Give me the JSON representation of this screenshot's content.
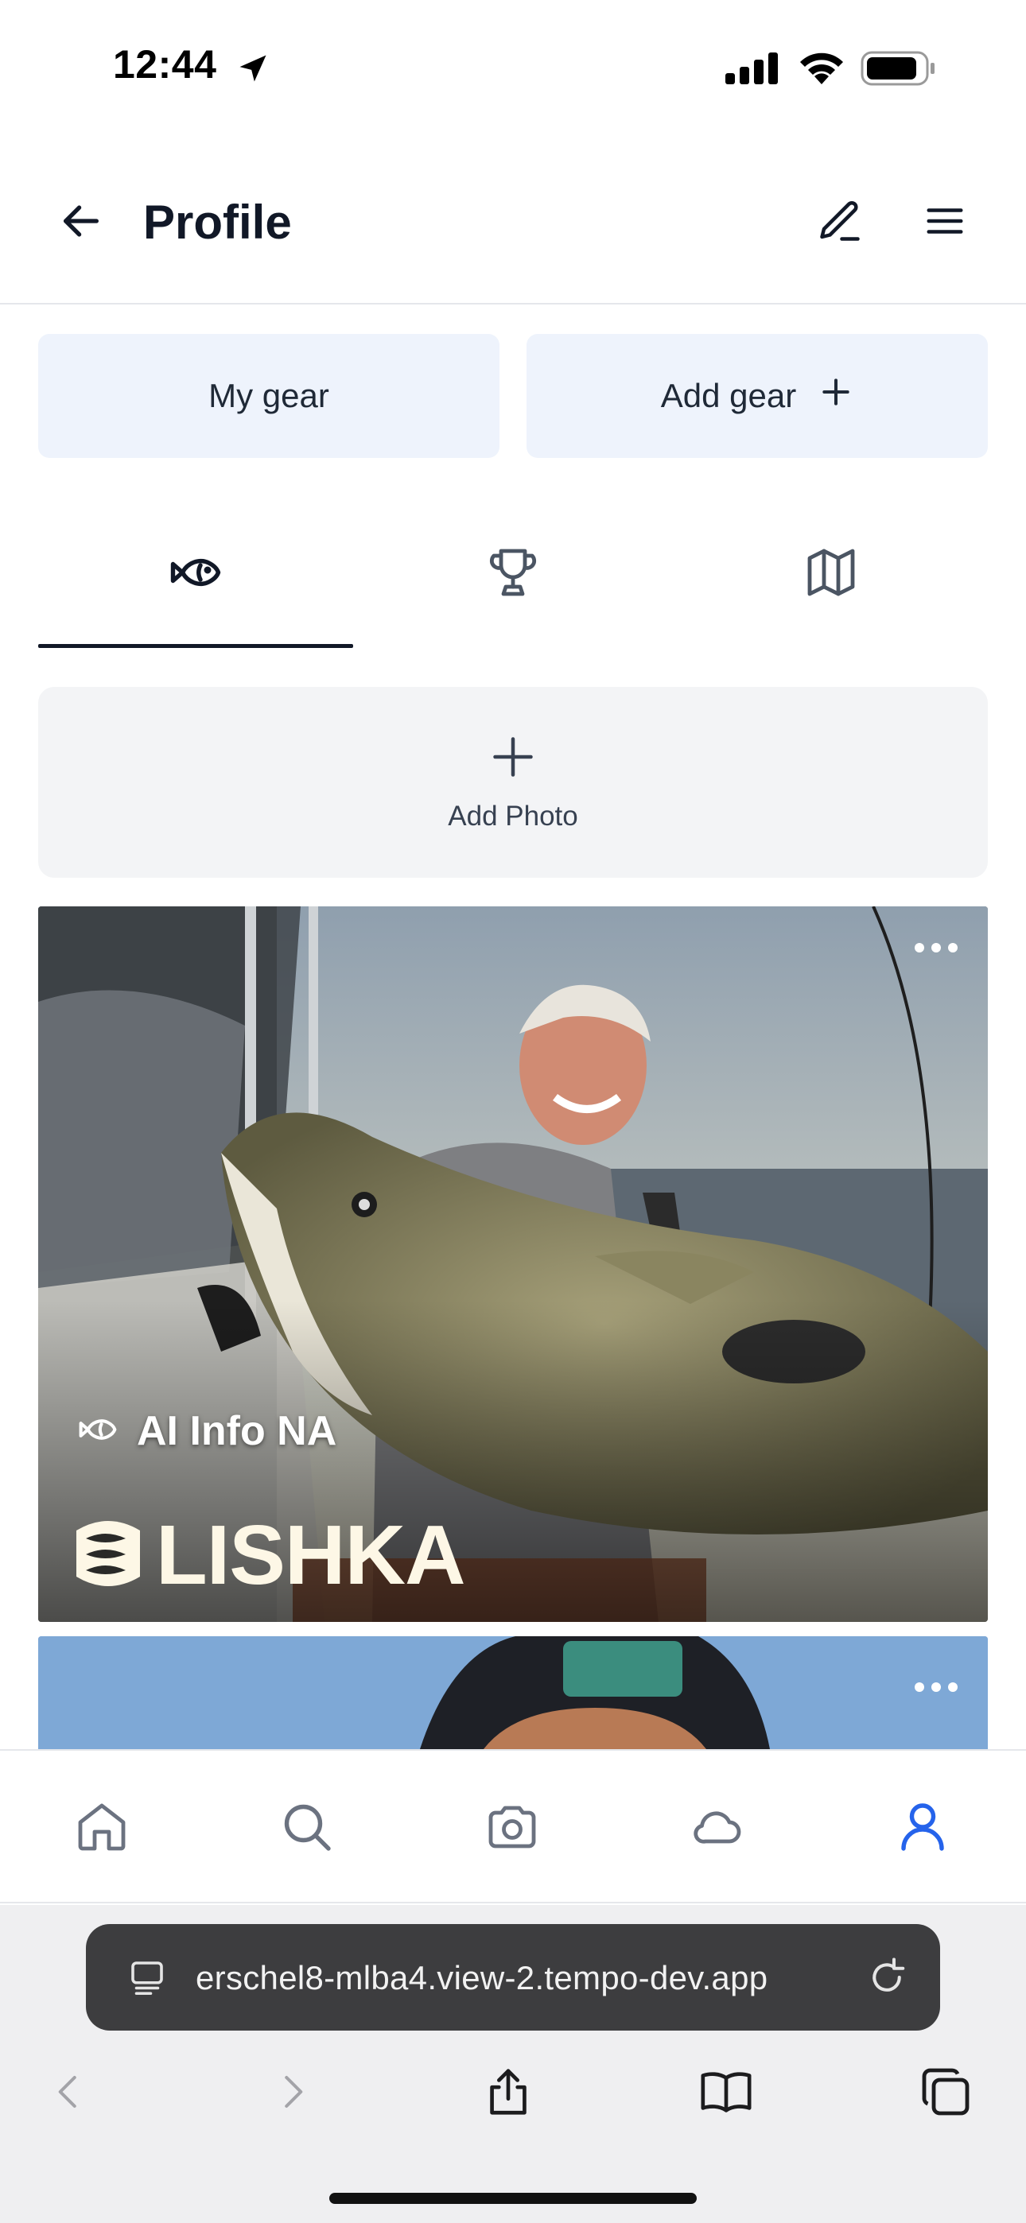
{
  "status_bar": {
    "time": "12:44",
    "icons": [
      "location-arrow-icon",
      "cellular-signal-icon",
      "wifi-icon",
      "battery-icon"
    ]
  },
  "header": {
    "title": "Profile",
    "back_icon": "arrow-left-icon",
    "edit_icon": "pencil-icon",
    "menu_icon": "hamburger-menu-icon"
  },
  "gear": {
    "my_gear_label": "My gear",
    "add_gear_label": "Add gear",
    "add_icon": "plus-icon"
  },
  "tabs": [
    {
      "icon": "fish-icon",
      "active": true
    },
    {
      "icon": "trophy-icon",
      "active": false
    },
    {
      "icon": "map-icon",
      "active": false
    }
  ],
  "add_photo": {
    "label": "Add Photo",
    "icon": "plus-icon"
  },
  "catches": [
    {
      "species": "AI Info NA",
      "brand": "LISHKA",
      "more_icon": "ellipsis-icon"
    },
    {
      "more_icon": "ellipsis-icon"
    }
  ],
  "bottom_nav": [
    {
      "icon": "home-icon",
      "active": false
    },
    {
      "icon": "search-icon",
      "active": false
    },
    {
      "icon": "camera-icon",
      "active": false
    },
    {
      "icon": "cloud-icon",
      "active": false
    },
    {
      "icon": "user-icon",
      "active": true
    }
  ],
  "colors": {
    "accent_blue": "#2563eb",
    "text_dark": "#111827",
    "gear_button_bg": "#eef3fc",
    "add_photo_bg": "#f3f4f6",
    "nav_icon_gray": "#6b7280"
  },
  "browser": {
    "url": "erschel8-mlba4.view-2.tempo-dev.app"
  }
}
